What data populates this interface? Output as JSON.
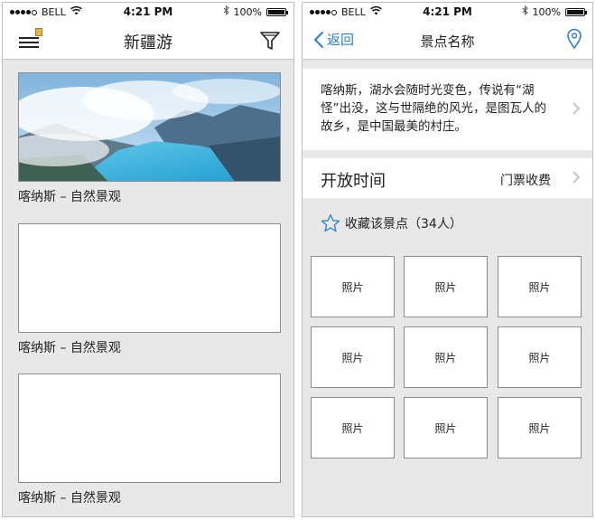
{
  "status_bar": {
    "carrier": "BELL",
    "time": "4:21 PM",
    "battery": "100%",
    "battery_level": 1.0,
    "signal_bars": 4,
    "signal_total": 5
  },
  "left_screen": {
    "nav_title": "新疆游",
    "cards": [
      {
        "caption": "喀纳斯 – 自然景观",
        "image": "lake-landscape-photo"
      },
      {
        "caption": "喀纳斯 – 自然景观",
        "image": "image-placeholder"
      },
      {
        "caption": "喀纳斯 – 自然景观",
        "image": "image-placeholder"
      }
    ]
  },
  "right_screen": {
    "back_label": "返回",
    "nav_title": "景点名称",
    "description": "喀纳斯，湖水会随时光变色，传说有“湖怪”出没，这与世隔绝的风光，是图瓦人的故乡，是中国最美的村庄。",
    "hours_label": "开放时间",
    "ticket_label": "门票收费",
    "favorite_label": "收藏该景点（34人）",
    "photos": [
      "照片",
      "照片",
      "照片",
      "照片",
      "照片",
      "照片",
      "照片",
      "照片",
      "照片"
    ]
  },
  "colors": {
    "accent": "#2a7fd6",
    "background": "#e8e8e8"
  }
}
